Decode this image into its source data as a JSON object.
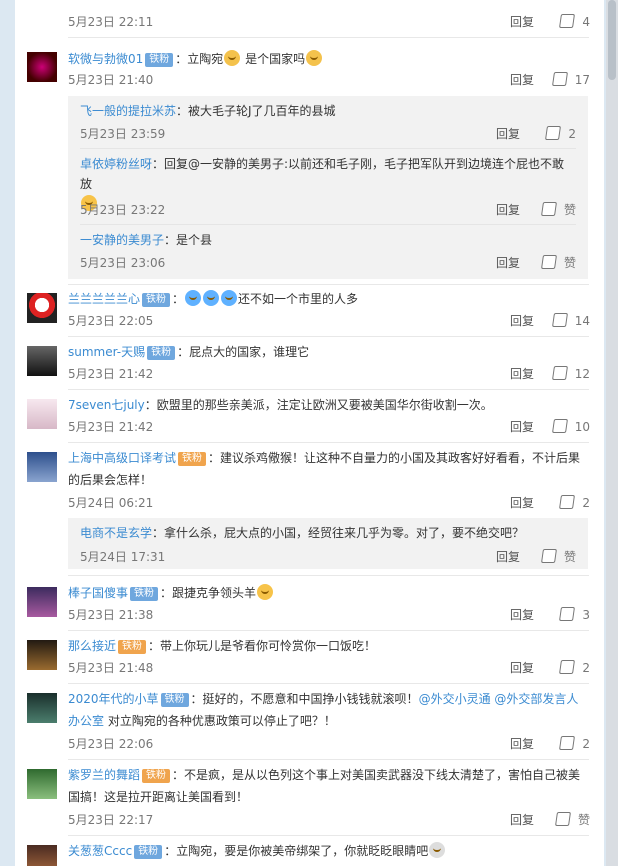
{
  "comments": [
    {
      "id": "c1",
      "user": "软微与勃微01",
      "badge": "铁粉",
      "text": "：立陶宛",
      "text2": " 是个国家吗",
      "time": "5月23日 21:40",
      "reply": "回复",
      "likes": "17",
      "replies": [
        {
          "user": "飞一般的提拉米苏",
          "text": "：被大毛子轮J了几百年的县城",
          "time": "5月23日 23:59",
          "reply": "回复",
          "likes": "2"
        },
        {
          "user": "卓依婷粉丝呀",
          "text": "：回复@一安静的美男子:以前还和毛子刚，毛子把军队开到边境连个屁也不敢放",
          "time": "5月23日 23:22",
          "reply": "回复",
          "likes": "赞"
        },
        {
          "user": "一安静的美男子",
          "text": "：是个县",
          "time": "5月23日 23:06",
          "reply": "回复",
          "likes": "赞"
        }
      ]
    },
    {
      "id": "c2",
      "user": "兰兰兰兰兰心",
      "badge": "铁粉",
      "text": "：",
      "text2": "还不如一个市里的人多",
      "time": "5月23日 22:05",
      "reply": "回复",
      "likes": "14"
    },
    {
      "id": "c3",
      "user": "summer-天赐",
      "badge": "铁粉",
      "text": "：屁点大的国家，谁理它",
      "time": "5月23日 21:42",
      "reply": "回复",
      "likes": "12"
    },
    {
      "id": "c4",
      "user": "7seven七july",
      "badge": "",
      "text": "：欧盟里的那些亲美派，注定让欧洲又要被美国华尔街收割一次。",
      "time": "5月23日 21:42",
      "reply": "回复",
      "likes": "10"
    },
    {
      "id": "c5",
      "user": "上海中高级口译考试",
      "badge": "铁粉",
      "text": "：建议杀鸡儆猴！让这种不自量力的小国及其政客好好看看，不计后果的后果会怎样！",
      "time": "5月24日 06:21",
      "reply": "回复",
      "likes": "2",
      "replies": [
        {
          "user": "电商不是玄学",
          "text": "：拿什么杀，屁大点的小国，经贸往来几乎为零。对了，要不绝交吧？",
          "time": "5月24日 17:31",
          "reply": "回复",
          "likes": "赞"
        }
      ]
    },
    {
      "id": "c6",
      "user": "棒子国傻事",
      "badge": "铁粉",
      "text": "：跟捷克争领头羊",
      "time": "5月23日 21:38",
      "reply": "回复",
      "likes": "3"
    },
    {
      "id": "c7",
      "user": "那么接近",
      "badge": "铁粉",
      "text": "：带上你玩儿是爷看你可怜赏你一口饭吃！",
      "time": "5月23日 21:48",
      "reply": "回复",
      "likes": "2"
    },
    {
      "id": "c8",
      "user": "2020年代的小草",
      "badge": "铁粉",
      "text": "：挺好的，不愿意和中国挣小钱钱就滚呗！",
      "mention": "@外交小灵通 @外交部发言人办公室",
      "text2": " 对立陶宛的各种优惠政策可以停止了吧？！",
      "time": "5月23日 22:06",
      "reply": "回复",
      "likes": "2"
    },
    {
      "id": "c9",
      "user": "紫罗兰的舞蹈",
      "badge": "铁粉",
      "text": "：不是疯，是从以色列这个事上对美国卖武器没下线太清楚了，害怕自己被美国搞！这是拉开距离让美国看到！",
      "time": "5月23日 22:17",
      "reply": "回复",
      "likes": "赞"
    },
    {
      "id": "c10",
      "user": "关葱葱Cccc",
      "badge": "铁粉",
      "text": "：立陶宛，要是你被美帝绑架了，你就眨眨眼睛吧",
      "time": "",
      "reply": "",
      "likes": ""
    }
  ],
  "topPartial": {
    "time": "5月23日 22:11",
    "reply": "回复",
    "likes": "4"
  }
}
